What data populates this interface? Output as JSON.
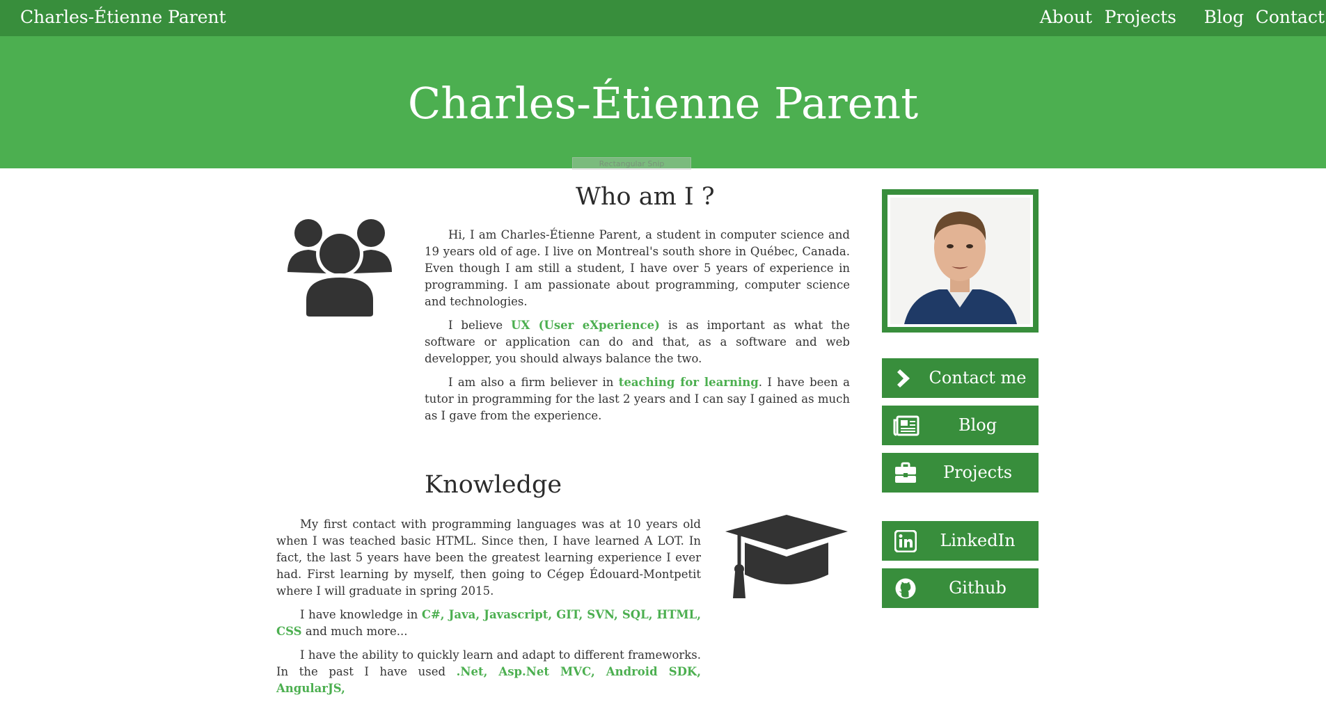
{
  "nav": {
    "brand": "Charles-Étienne Parent",
    "items": [
      "About",
      "Projects",
      "Blog",
      "Contact"
    ]
  },
  "hero": {
    "title": "Charles-Étienne Parent"
  },
  "overlay": {
    "snip_label": "Rectangular Snip"
  },
  "about": {
    "title": "Who am I ?",
    "p1": "Hi, I am Charles-Étienne Parent, a student in computer science and 19 years old of age. I live on Montreal's south shore in Québec, Canada. Even though I am still a student, I have over 5 years of experience in programming. I am passionate about programming, computer science and technologies.",
    "p2_pre": "I believe ",
    "p2_hl": "UX (User eXperience)",
    "p2_post": " is as important as what the software or application can do and that, as a software and web developper, you should always balance the two.",
    "p3_pre": "I am also a firm believer in ",
    "p3_hl": "teaching for learning",
    "p3_post": ". I have been a tutor in programming for the last 2 years and I can say I gained as much as I gave from the experience."
  },
  "knowledge": {
    "title": "Knowledge",
    "p1": "My first contact with programming languages was at 10 years old when I was teached basic HTML. Since then, I have learned A LOT. In fact, the last 5 years have been the greatest learning experience I ever had. First learning by myself, then going to Cégep Édouard-Montpetit where I will graduate in spring 2015.",
    "p2_pre": "I have knowledge in ",
    "p2_hl": "C#, Java, Javascript, GIT, SVN, SQL, HTML, CSS",
    "p2_post": " and much more...",
    "p3_pre": "I have the ability to quickly learn and adapt to different frameworks. In the past I have used ",
    "p3_hl": ".Net, Asp.Net MVC, Android SDK, AngularJS,"
  },
  "sidebar": {
    "buttons": [
      {
        "label": "Contact me",
        "icon": "chevron-right-icon"
      },
      {
        "label": "Blog",
        "icon": "newspaper-icon"
      },
      {
        "label": "Projects",
        "icon": "briefcase-icon"
      },
      {
        "label": "LinkedIn",
        "icon": "linkedin-icon"
      },
      {
        "label": "Github",
        "icon": "github-icon"
      }
    ]
  },
  "colors": {
    "nav_green": "#388e3c",
    "hero_green": "#4caf50",
    "highlight_green": "#4caf50",
    "icon_dark": "#333333"
  }
}
